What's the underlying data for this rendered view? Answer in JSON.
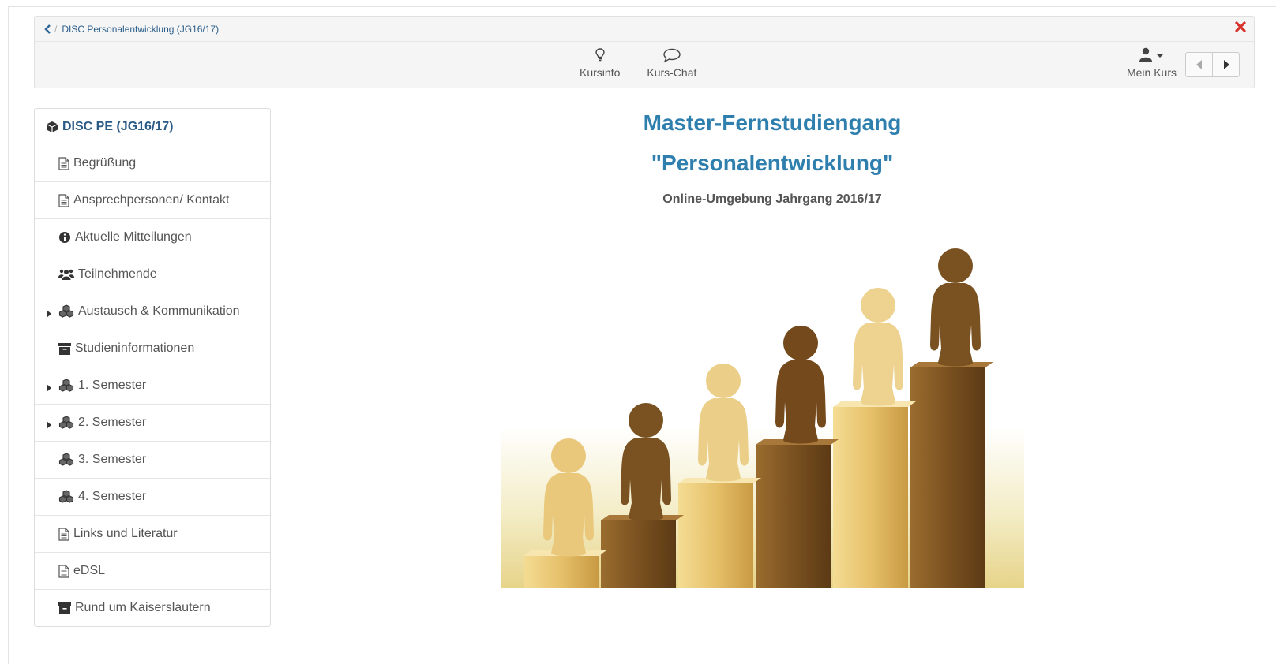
{
  "breadcrumb": {
    "title": "DISC Personalentwicklung (JG16/17)"
  },
  "toolbar": {
    "tools": [
      {
        "label": "Kursinfo",
        "icon": "lightbulb-icon"
      },
      {
        "label": "Kurs-Chat",
        "icon": "chat-bubble-icon"
      }
    ],
    "mein_kurs": "Mein Kurs"
  },
  "colors": {
    "accent": "#2e7fae",
    "close": "#d9302b",
    "link": "#2a6496"
  },
  "sidebar": {
    "root": "DISC PE (JG16/17)",
    "items": [
      {
        "label": "Begrüßung",
        "icon": "document-icon",
        "expandable": false
      },
      {
        "label": "Ansprechpersonen/ Kontakt",
        "icon": "document-icon",
        "expandable": false
      },
      {
        "label": "Aktuelle Mitteilungen",
        "icon": "info-circle-icon",
        "expandable": false
      },
      {
        "label": "Teilnehmende",
        "icon": "users-icon",
        "expandable": false
      },
      {
        "label": "Austausch & Kommunikation",
        "icon": "cubes-icon",
        "expandable": true
      },
      {
        "label": "Studieninformationen",
        "icon": "archive-icon",
        "expandable": false
      },
      {
        "label": "1. Semester",
        "icon": "cubes-icon",
        "expandable": true
      },
      {
        "label": "2. Semester",
        "icon": "cubes-icon",
        "expandable": true
      },
      {
        "label": "3. Semester",
        "icon": "cubes-icon",
        "expandable": false
      },
      {
        "label": "4. Semester",
        "icon": "cubes-icon",
        "expandable": false
      },
      {
        "label": "Links und Literatur",
        "icon": "document-icon",
        "expandable": false
      },
      {
        "label": "eDSL",
        "icon": "document-icon",
        "expandable": false
      },
      {
        "label": "Rund um Kaiserslautern",
        "icon": "archive-icon",
        "expandable": false
      }
    ]
  },
  "content": {
    "title_line1": "Master-Fernstudiengang",
    "title_line2": "\"Personalentwicklung\"",
    "subtitle": "Online-Umgebung Jahrgang 2016/17"
  }
}
